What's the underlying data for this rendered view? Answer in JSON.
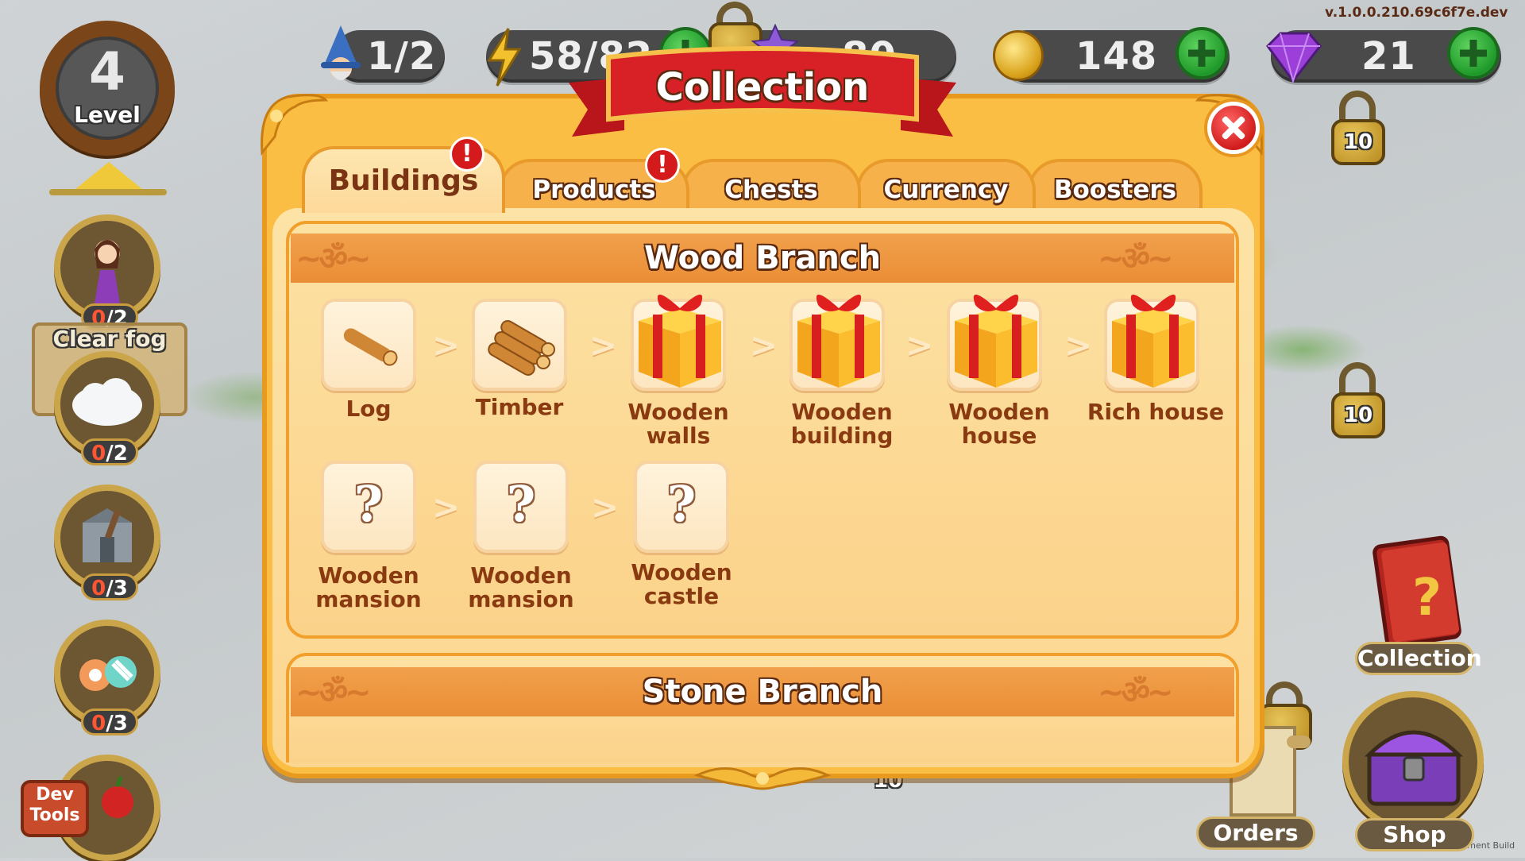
{
  "version": "v.1.0.0.210.69c6f7e.dev",
  "footer_note": "Development Build",
  "level": {
    "number": "4",
    "label": "Level"
  },
  "resources": {
    "wizards": "1/2",
    "energy": "58/82",
    "hidden_value": "80",
    "coins": "148",
    "gems": "21"
  },
  "left_quests": {
    "clear_fog_label": "Clear fog",
    "counts": [
      {
        "num": "0",
        "rest": "/2"
      },
      {
        "num": "0",
        "rest": "/2"
      },
      {
        "num": "0",
        "rest": "/3"
      },
      {
        "num": "0",
        "rest": "/3"
      }
    ]
  },
  "dev_tools_label": "Dev Tools",
  "right_panel": {
    "locks": [
      "10",
      "10",
      "10"
    ],
    "collection_label": "Collection",
    "orders_label": "Orders",
    "shop_label": "Shop"
  },
  "modal": {
    "title": "Collection",
    "tabs": [
      {
        "label": "Buildings",
        "alert": "!"
      },
      {
        "label": "Products",
        "alert": "!"
      },
      {
        "label": "Chests"
      },
      {
        "label": "Currency"
      },
      {
        "label": "Boosters"
      }
    ],
    "arrow": ">",
    "unknown": "?",
    "wood_branch": {
      "title": "Wood Branch",
      "row1": [
        {
          "label": "Log",
          "icon": "log-icon"
        },
        {
          "label": "Timber",
          "icon": "timber-icon"
        },
        {
          "label": "Wooden walls",
          "icon": "gift-icon"
        },
        {
          "label": "Wooden building",
          "icon": "gift-icon"
        },
        {
          "label": "Wooden house",
          "icon": "gift-icon"
        },
        {
          "label": "Rich house",
          "icon": "gift-icon"
        }
      ],
      "row2": [
        {
          "label": "Wooden mansion",
          "icon": "question-icon"
        },
        {
          "label": "Wooden mansion",
          "icon": "question-icon"
        },
        {
          "label": "Wooden castle",
          "icon": "question-icon"
        }
      ]
    },
    "stone_branch": {
      "title": "Stone Branch"
    }
  }
}
